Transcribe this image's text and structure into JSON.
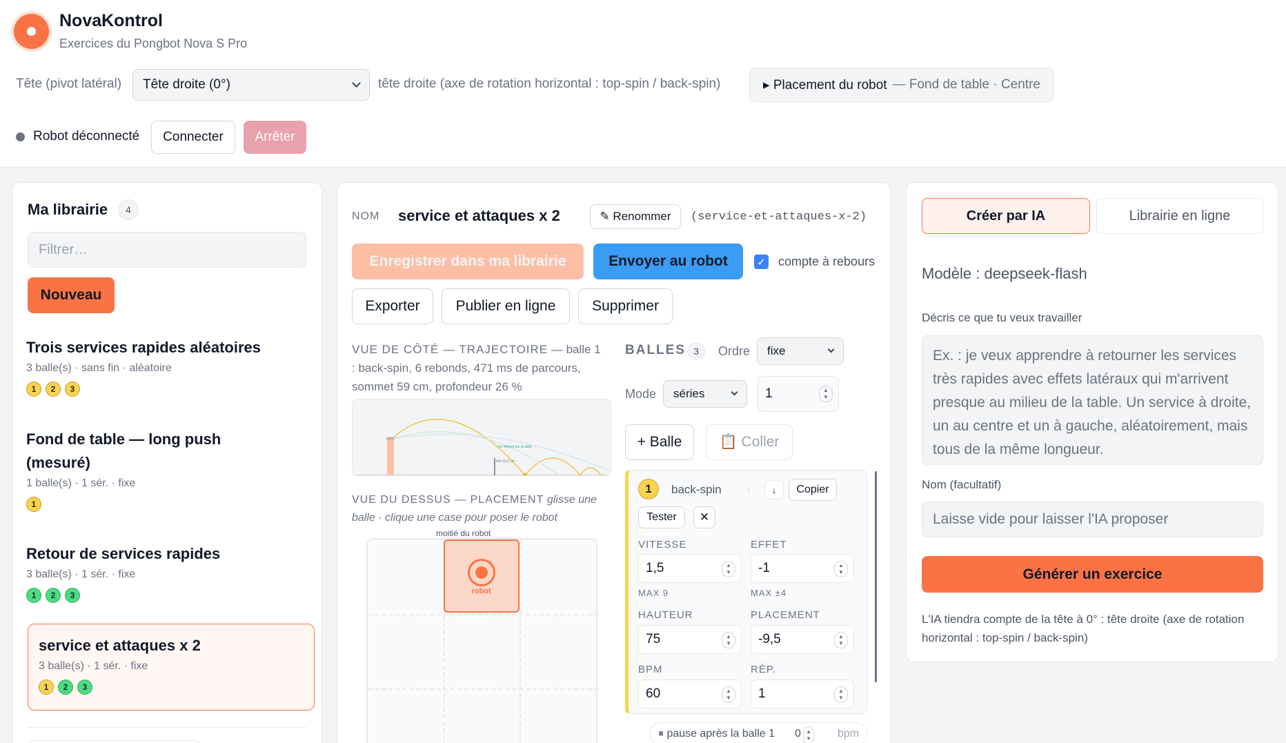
{
  "app": {
    "name": "NovaKontrol",
    "subtitle": "Exercices du Pongbot Nova S Pro"
  },
  "head": {
    "label": "Tête (pivot latéral)",
    "selected": "Tête droite (0°)",
    "description": "tête droite (axe de rotation horizontal : top-spin / back-spin)",
    "placement_label": "▸ Placement du robot",
    "placement_value": "— Fond de table · Centre"
  },
  "connection": {
    "status": "Robot déconnecté",
    "status_color": "#6b7280",
    "connect": "Connecter",
    "stop": "Arrêter"
  },
  "library": {
    "title": "Ma librairie",
    "count": "4",
    "filter_placeholder": "Filtrer…",
    "new_button": "Nouveau",
    "items": [
      {
        "title": "Trois services rapides aléatoires",
        "meta": "3 balle(s) · sans fin · aléatoire",
        "dots": [
          "1",
          "2",
          "3"
        ],
        "dot_color": "yellow"
      },
      {
        "title": "Fond de table — long push (mesuré)",
        "meta": "1 balle(s) · 1 sér. · fixe",
        "dots": [
          "1"
        ],
        "dot_color": "yellow"
      },
      {
        "title": "Retour de services rapides",
        "meta": "3 balle(s) · 1 sér. · fixe",
        "dots": [
          "1",
          "2",
          "3"
        ],
        "dot_color": "green"
      },
      {
        "title": "service et attaques x 2",
        "meta": "3 balle(s) · 1 sér. · fixe",
        "dots": [
          "1",
          "2",
          "3"
        ],
        "dot_color": "mixed"
      }
    ]
  },
  "editor": {
    "name_label": "NOM",
    "name": "service et attaques x 2",
    "rename": "✎ Renommer",
    "slug": "(service-et-attaques-x-2)",
    "save": "Enregistrer dans ma librairie",
    "send": "Envoyer au robot",
    "countdown": "compte à rebours",
    "export": "Exporter",
    "publish": "Publier en ligne",
    "delete": "Supprimer",
    "side_view_title": "VUE DE CÔTÉ — TRAJECTOIRE",
    "side_view_info": "— balle 1 : back-spin, 6 rebonds, 471 ms de parcours, sommet 59 cm, profondeur 26 %",
    "side_view_small": {
      "robot": "robot",
      "bounce": "1er rebond sur la table",
      "net": "filet 15,3 cm"
    },
    "top_view_title": "VUE DU DESSUS — PLACEMENT",
    "top_view_hint": "glisse une balle · clique une case pour poser le robot",
    "top_view_half": "moitié du robot",
    "robot_label": "robot"
  },
  "balls": {
    "title": "BALLES",
    "count": "3",
    "order_label": "Ordre",
    "order_value": "fixe",
    "mode_label": "Mode",
    "mode_value": "séries",
    "series_count": "1",
    "add_ball": "+ Balle",
    "paste": "📋 Coller",
    "card": {
      "index": "1",
      "type": "back-spin",
      "copy": "Copier",
      "test": "Tester",
      "speed_label": "VITESSE",
      "speed": "1,5",
      "speed_max": "MAX 9",
      "effect_label": "EFFET",
      "effect": "-1",
      "effect_max": "MAX ±4",
      "height_label": "HAUTEUR",
      "height": "75",
      "placement_label": "PLACEMENT",
      "placement": "-9,5",
      "bpm_label": "BPM",
      "bpm": "60",
      "rep_label": "RÉP.",
      "rep": "1"
    },
    "pause_label": "⏸ pause après la balle 1",
    "pause_value": "0",
    "pause_unit": "bpm"
  },
  "ai": {
    "tab_create": "Créer par IA",
    "tab_online": "Librairie en ligne",
    "model": "Modèle : deepseek-flash",
    "describe_label": "Décris ce que tu veux travailler",
    "describe_placeholder": "Ex. : je veux apprendre à retourner les services très rapides avec effets latéraux qui m'arrivent presque au milieu de la table. Un service à droite, un au centre et un à gauche, aléatoirement, mais tous de la même longueur.",
    "name_label": "Nom (facultatif)",
    "name_placeholder": "Laisse vide pour laisser l'IA proposer",
    "generate": "Générer un exercice",
    "note": "L'IA tiendra compte de la tête à 0° : tête droite (axe de rotation horizontal : top-spin / back-spin)"
  },
  "colors": {
    "accent": "#fb7345",
    "blue": "#3b9cf6",
    "save_disabled": "#fdbea6",
    "stop_disabled": "#e9a1ad"
  }
}
